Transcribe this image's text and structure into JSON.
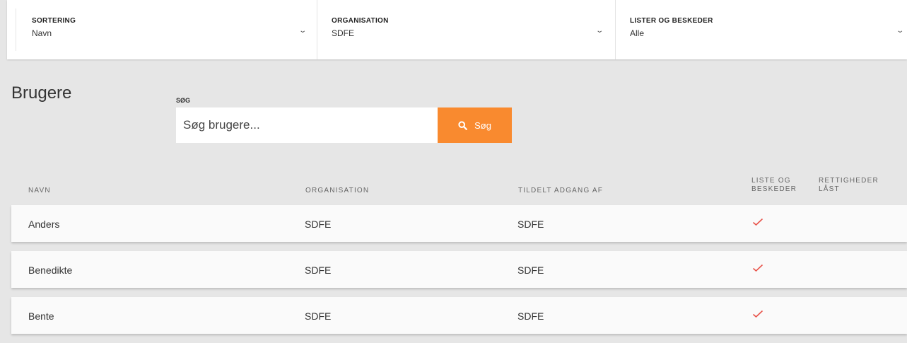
{
  "filters": [
    {
      "label": "SORTERING",
      "value": "Navn"
    },
    {
      "label": "ORGANISATION",
      "value": "SDFE"
    },
    {
      "label": "LISTER OG BESKEDER",
      "value": "Alle"
    }
  ],
  "page_title": "Brugere",
  "search": {
    "label": "SØG",
    "placeholder": "Søg brugere...",
    "button_label": "Søg"
  },
  "table": {
    "columns": {
      "name": "NAVN",
      "organisation": "ORGANISATION",
      "granted_by": "TILDELT ADGANG AF",
      "lists_line1": "LISTE OG",
      "lists_line2": "BESKEDER",
      "rights_line1": "RETTIGHEDER",
      "rights_line2": "LÅST"
    },
    "rows": [
      {
        "name": "Anders",
        "organisation": "SDFE",
        "granted_by": "SDFE",
        "lists_and_messages": true,
        "rights_locked": false
      },
      {
        "name": "Benedikte",
        "organisation": "SDFE",
        "granted_by": "SDFE",
        "lists_and_messages": true,
        "rights_locked": false
      },
      {
        "name": "Bente",
        "organisation": "SDFE",
        "granted_by": "SDFE",
        "lists_and_messages": true,
        "rights_locked": false
      }
    ]
  },
  "colors": {
    "accent": "#f98a2f",
    "check": "#e8534a",
    "background": "#e6e6e6"
  },
  "icons": {
    "search": "search-icon",
    "dropdown": "chevron-down-icon",
    "check": "check-icon"
  }
}
